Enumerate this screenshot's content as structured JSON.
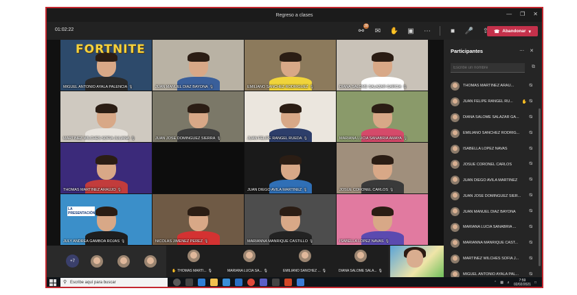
{
  "window": {
    "title": "Regreso a clases"
  },
  "toolbar": {
    "timer": "01:02:22",
    "participants_badge": "28",
    "leave_label": "Abandonar"
  },
  "tiles": [
    {
      "name": "MIGUEL ANTONIO AYALA PALENCIA",
      "banner": "FORTNITE",
      "bg": "#2d4a6b",
      "shirt": "#2a2a2a"
    },
    {
      "name": "JUAN MANUEL DIAZ BAYONA",
      "bg": "#b9b2a4",
      "shirt": "#3a5f9a"
    },
    {
      "name": "EMILIANO  SANCHEZ RODRIGUEZ",
      "bg": "#8c7a5c",
      "shirt": "#f0d43a"
    },
    {
      "name": "DIANA  SALOME SALAZAR GARCIA",
      "bg": "#c9c2b8",
      "shirt": "#ffffff"
    },
    {
      "name": "MARTINEZ WILCHES SOFIA JULIANA",
      "bg": "#cfc9c0",
      "shirt": "#e8e4de"
    },
    {
      "name": "JUAN JOSE DOMINGUEZ  SIERRA",
      "bg": "#7b7868",
      "shirt": "#3b3b3b"
    },
    {
      "name": "JUAN FELIPE RANGEL RUEDA",
      "bg": "#ebe6de",
      "shirt": "#2d3e6a"
    },
    {
      "name": "MARIANA LUCIA SANABRIA AMAYA",
      "bg": "#8a9a6a",
      "shirt": "#d54a6a"
    },
    {
      "name": "THOMAS  MARTINEZ ARAUJO",
      "bg": "#3b2a7a",
      "shirt": "#c23c3c"
    },
    {
      "name": "",
      "bg": "#0d0d0d",
      "shirt": "#0d0d0d",
      "empty": true
    },
    {
      "name": "JUAN DIEGO AVILA MARTINEZ",
      "bg": "#1a1a1a",
      "shirt": "#2f6fb6"
    },
    {
      "name": "JOSUE  CORONEL CARLOS",
      "bg": "#a08f7c",
      "shirt": "#3a3a3a"
    },
    {
      "name": "JULY ANDREA GAMBOA ROJAS",
      "banner": "LA PRESENTACIÓN",
      "bg": "#3b8fc9",
      "shirt": "#1e1e1e"
    },
    {
      "name": "NICOLAS  JIMENEZ PEREZ",
      "bg": "#6f5a45",
      "shirt": "#d43232"
    },
    {
      "name": "MARIANNA  MANRIQUE CASTILLO",
      "bg": "#4d4d4d",
      "shirt": "#222222"
    },
    {
      "name": "ISABELLA  LOPEZ NAVAS",
      "bg": "#e17aa0",
      "shirt": "#5b4ab0"
    }
  ],
  "sidebar": {
    "title": "Participantes",
    "search_placeholder": "Escribe un nombre",
    "participants": [
      {
        "name": "THOMAS MARTINEZ ARAU...",
        "hand": false
      },
      {
        "name": "JUAN FELIPE RANGEL RU...",
        "hand": true
      },
      {
        "name": "DIANA SALOME SALAZAR GA...",
        "hand": false
      },
      {
        "name": "EMILIANO SANCHEZ RODRIG...",
        "hand": false
      },
      {
        "name": "ISABELLA LOPÉZ NAVAS",
        "hand": false
      },
      {
        "name": "JOSUE CORONEL CARLOS",
        "hand": false
      },
      {
        "name": "JUAN DIEGO AVILA MARTINEZ",
        "hand": false
      },
      {
        "name": "JUAN JOSE DOMINGUEZ SIER...",
        "hand": false
      },
      {
        "name": "JUAN MANUEL DIAZ BAYONA",
        "hand": false
      },
      {
        "name": "MARIANA LUCIA SANABRIA ...",
        "hand": false
      },
      {
        "name": "MARIANNA MANRIQUE CAST...",
        "hand": false
      },
      {
        "name": "MARTINEZ WILCHES SOFIA J...",
        "hand": false
      },
      {
        "name": "MIGUEL ANTONIO AYALA PAL...",
        "hand": false
      }
    ]
  },
  "bottom": {
    "overflow_label": "+7",
    "strip": [
      {
        "name": "THOMAS MARTI...",
        "hand": true
      },
      {
        "name": "MARIANA LUCIA SA...",
        "hand": false
      },
      {
        "name": "EMILIANO SANCHEZ ...",
        "hand": false
      },
      {
        "name": "DIANA SALOME SALA...",
        "hand": false
      }
    ]
  },
  "taskbar": {
    "search_placeholder": "Escribe aquí para buscar",
    "time": "7:59",
    "date": "02/02/2021"
  }
}
